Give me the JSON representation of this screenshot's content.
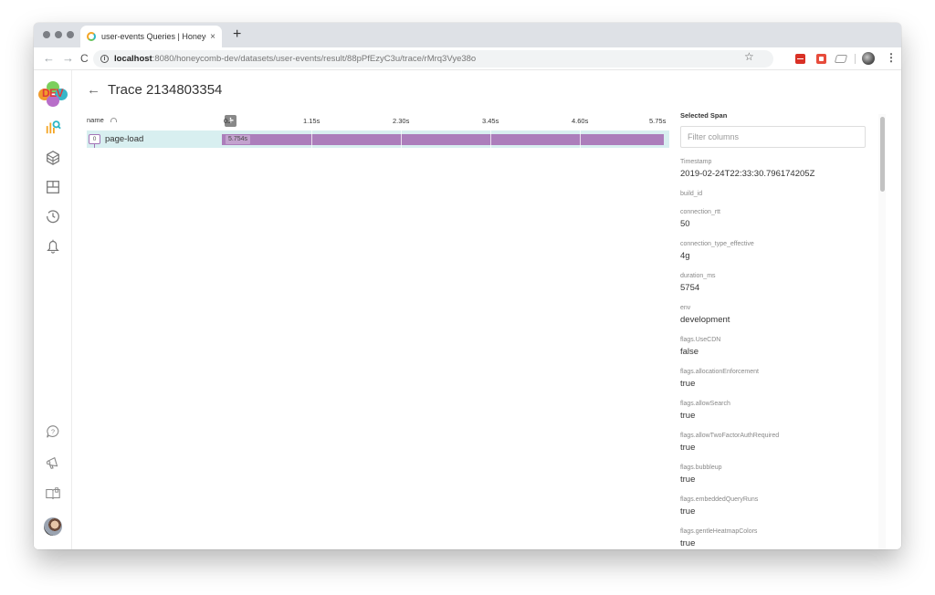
{
  "browser": {
    "tab_title": "user-events Queries | Honeycomb",
    "url_host": "localhost",
    "url_rest": ":8080/honeycomb-dev/datasets/user-events/result/88pPfEzyC3u/trace/rMrq3Vye38o",
    "new_tab_label": "+",
    "close_tab_label": "×"
  },
  "sidebar": {
    "logo_text": "DEV",
    "items": [
      {
        "icon": "query-icon",
        "active": true
      },
      {
        "icon": "datasets-icon"
      },
      {
        "icon": "boards-icon"
      },
      {
        "icon": "history-icon"
      },
      {
        "icon": "triggers-bell-icon"
      }
    ],
    "bottom_items": [
      {
        "icon": "help-icon"
      },
      {
        "icon": "announcements-icon"
      },
      {
        "icon": "docs-book-icon"
      },
      {
        "icon": "user-avatar"
      }
    ]
  },
  "header": {
    "back_label": "←",
    "title": "Trace 2134803354"
  },
  "trace": {
    "name_column": "name",
    "expand_label": "+",
    "ticks": [
      "0s",
      "1.15s",
      "2.30s",
      "3.45s",
      "4.60s",
      "5.75s"
    ],
    "axis_max_s": 5.75,
    "spans": [
      {
        "index": "0",
        "name": "page-load",
        "start_s": 0,
        "duration_s": 5.754,
        "duration_label": "5.754s",
        "color": "#ac7ebb",
        "selected": true
      }
    ]
  },
  "panel": {
    "title": "Selected Span",
    "filter_placeholder": "Filter columns",
    "fields": [
      {
        "key": "Timestamp",
        "value": "2019-02-24T22:33:30.796174205Z"
      },
      {
        "key": "build_id",
        "value": ""
      },
      {
        "key": "connection_rtt",
        "value": "50"
      },
      {
        "key": "connection_type_effective",
        "value": "4g"
      },
      {
        "key": "duration_ms",
        "value": "5754"
      },
      {
        "key": "env",
        "value": "development"
      },
      {
        "key": "flags.UseCDN",
        "value": "false"
      },
      {
        "key": "flags.allocationEnforcement",
        "value": "true"
      },
      {
        "key": "flags.allowSearch",
        "value": "true"
      },
      {
        "key": "flags.allowTwoFactorAuthRequired",
        "value": "true"
      },
      {
        "key": "flags.bubbleup",
        "value": "true"
      },
      {
        "key": "flags.embeddedQueryRuns",
        "value": "true"
      },
      {
        "key": "flags.gentleHeatmapColors",
        "value": "true"
      }
    ]
  },
  "colors": {
    "selected_row": "#d8eff0",
    "span_bar": "#ac7ebb",
    "accent_orange": "#f4a523",
    "accent_teal": "#2db7c6"
  }
}
